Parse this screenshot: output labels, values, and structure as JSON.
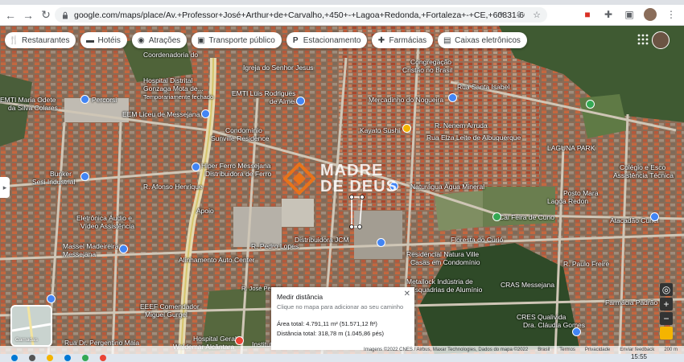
{
  "browser": {
    "url": "google.com/maps/place/Av.+Professor+José+Arthur+de+Carvalho,+450+-+Lagoa+Redonda,+Fortaleza+-+CE,+60831-600/@-3.8258148,-38.476..."
  },
  "chips": [
    {
      "label": "Restaurantes",
      "icon": "fork-knife-icon"
    },
    {
      "label": "Hotéis",
      "icon": "bed-icon"
    },
    {
      "label": "Atrações",
      "icon": "camera-icon"
    },
    {
      "label": "Transporte público",
      "icon": "bus-icon"
    },
    {
      "label": "Estacionamento",
      "icon": "parking-icon"
    },
    {
      "label": "Farmácias",
      "icon": "pharmacy-icon"
    },
    {
      "label": "Caixas eletrônicos",
      "icon": "atm-icon"
    }
  ],
  "map_labels": {
    "coordenadoria": "Coordenadoria do",
    "igreja": "Igreja do Senhor Jesus",
    "congregacao": "Congregação",
    "cristao": "Cristão no Brasil",
    "hospital_distrital": "Hospital Distrital",
    "gonzaga": "Gonzaga Mota de...",
    "temp_fechado": "Temporariamente fechado",
    "emt_luis": "EMTI Luis Rodrigues",
    "de_almeida": "de Almeida",
    "mercadinho": "Mercadinho do Nogueira",
    "rua_santa_isabel": "Rua Santa Isabel",
    "emti_maria": "EMTI Maria Odete",
    "da_silva": "da Silva Colares",
    "percorsi": "Percorsi",
    "eem_liceu": "EEM Liceu de Messejana",
    "condominio": "Condomínio",
    "sunville": "Sunville Residence",
    "kayato": "Kayato Sushi",
    "r_nenem": "R. Nenem Arruda",
    "rua_elza": "Rua Elza Leite de Albuquerque",
    "laguna_park": "LAGUNA PARK",
    "colegio": "Colégio e Esco",
    "assistencia": "Assistência Técnica",
    "hiper_ferro": "Hiper Ferro Messejana",
    "distribuidora": "Distribuidora de Ferro",
    "r_afonso": "R. Afonso Henrique",
    "naturagua": "Naturágua Água Mineral",
    "posto": "Posto Mara",
    "lagoa_red": "Lagoa Redon",
    "cai_feira": "Cai Feira de Cuno",
    "bunker": "Bunker",
    "sesi": "Sesi Industrial",
    "apoio": "Apoio",
    "eletronica": "Eletrônica Áudio e",
    "video": "Vídeo Assistência",
    "distribuidora_jcm": "Distribuidora JCM",
    "r_pedro": "R. Pedro Lopes",
    "residencial": "Residencial Natura Ville",
    "casas": "Casas em Condomínio",
    "massei": "Massel Madeireira",
    "messejana": "Messejana",
    "alinhamento": "Alinhamento Auto Center",
    "metallock": "Metallock Indústria de",
    "esquadrias": "Esquadrias de Alumínio",
    "floresta": "Floresta do Curió",
    "r_paulo": "R. Paulo Freire",
    "cras": "CRAS Messejana",
    "farmacia": "Farmácia Padrão",
    "eeef": "EEEF Comendador",
    "miguel": "Miguel Gurgel",
    "cres": "CRES Qualivida",
    "dra": "Dra. Cláudia Gomes",
    "hospital_geral": "Hospital Geral",
    "waldemar": "Waldemar Alcântara",
    "instituto": "Instituto de Saúde",
    "rua_dr": "Rua Dr. Pergentino Maia",
    "atacadao": "Atacadão Cunel",
    "jose_pereira": "R. José Pereira"
  },
  "watermark": {
    "line1": "MADRE",
    "line2": "DE DEUS"
  },
  "measure": {
    "title": "Medir distância",
    "hint": "Clique no mapa para adicionar ao seu caminho",
    "area": "Área total: 4.791,11 m² (51.571,12 ft²)",
    "distance": "Distância total: 318,78 m (1.045,86 pés)"
  },
  "layers_label": "Camadas",
  "attribution": {
    "imagery": "Imagens ©2022 CNES / Airbus, Maxar Technologies, Dados do mapa ©2022",
    "country": "Brasil",
    "terms": "Termos",
    "privacy": "Privacidade",
    "feedback": "Enviar feedback",
    "scale": "200 m"
  },
  "taskbar": {
    "clock": "15:55"
  },
  "colors": {
    "chip_bg": "#ffffff",
    "measure_line": "#ffffff",
    "accent_orange": "#e8731a"
  }
}
